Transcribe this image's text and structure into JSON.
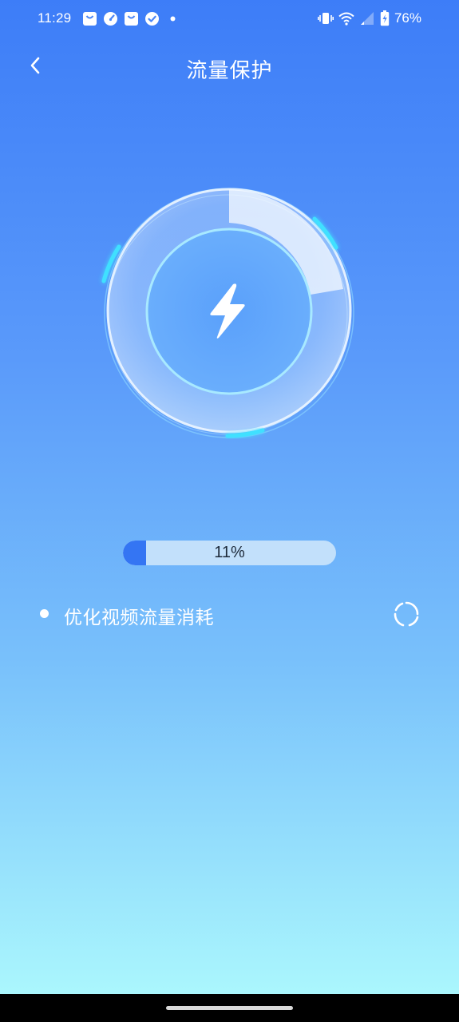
{
  "status_bar": {
    "time": "11:29",
    "notification_icons": [
      "shopping-bag-icon",
      "speedometer-icon",
      "shopping-bag-icon",
      "check-circle-icon",
      "dot-icon"
    ],
    "system_icons": [
      "vibrate-icon",
      "wifi-icon",
      "signal-icon",
      "battery-charging-icon"
    ],
    "battery_percent": "76%"
  },
  "header": {
    "title": "流量保护",
    "back_icon": "chevron-left-icon"
  },
  "ring_graphic": {
    "center_icon": "lightning-bolt-icon"
  },
  "progress": {
    "value": 0.11,
    "label": "11%",
    "fill_color": "#3475f3",
    "track_color": "#c2e0fb"
  },
  "task": {
    "label": "优化视频流量消耗",
    "status_icon": "loading-spinner-icon"
  },
  "colors": {
    "gradient_top": "#3d7df8",
    "gradient_bottom": "#aaf6fd",
    "accent_cyan": "#3fe0ff"
  }
}
